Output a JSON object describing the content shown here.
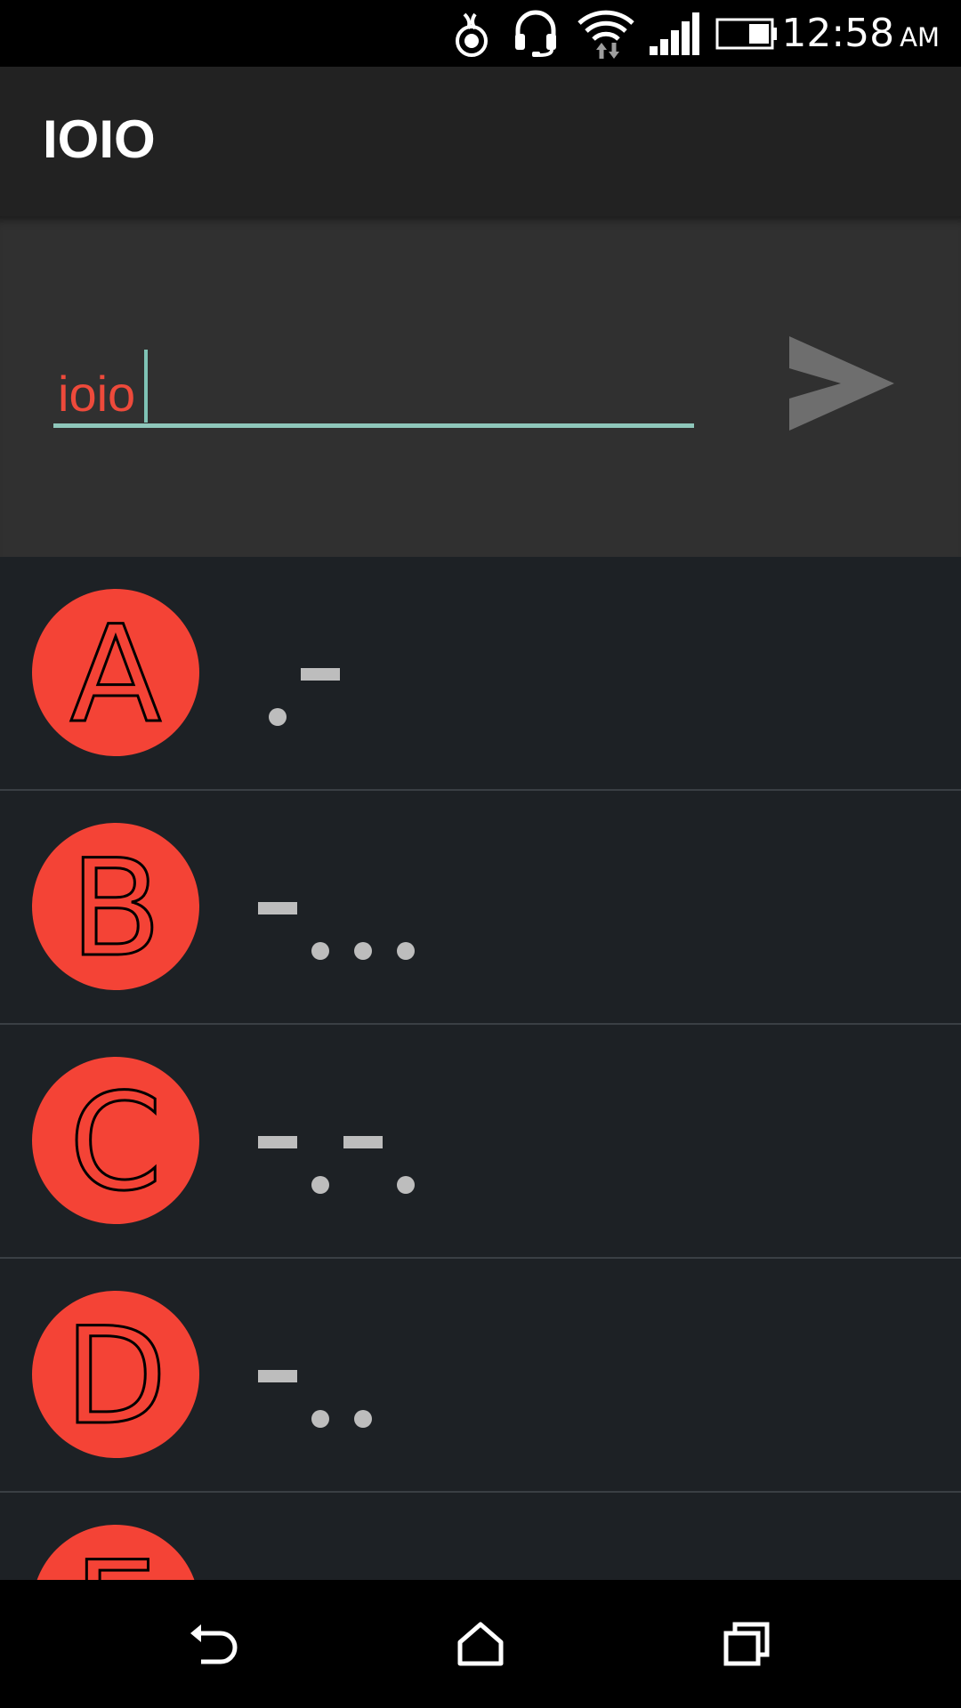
{
  "status_bar": {
    "time": "12:58",
    "ampm": "AM",
    "icons": [
      "sync-icon",
      "headset-icon",
      "wifi-icon",
      "signal-icon",
      "battery-icon"
    ]
  },
  "app_bar": {
    "title": "IOIO"
  },
  "input": {
    "value": "ioio"
  },
  "send_button": {
    "icon": "send-icon"
  },
  "list": {
    "items": [
      {
        "letter": "A",
        "code": ".-"
      },
      {
        "letter": "B",
        "code": "-..."
      },
      {
        "letter": "C",
        "code": "-.-."
      },
      {
        "letter": "D",
        "code": "-.."
      },
      {
        "letter": "E",
        "code": "."
      }
    ]
  },
  "nav_bar": {
    "icons": [
      "back-icon",
      "home-icon",
      "recents-icon"
    ]
  },
  "colors": {
    "accent": "#f44336",
    "input_text": "#ee4a3b",
    "underline": "#8fc7bb",
    "list_bg": "#1d2125",
    "panel_bg": "#303030",
    "app_bar_bg": "#222222"
  }
}
